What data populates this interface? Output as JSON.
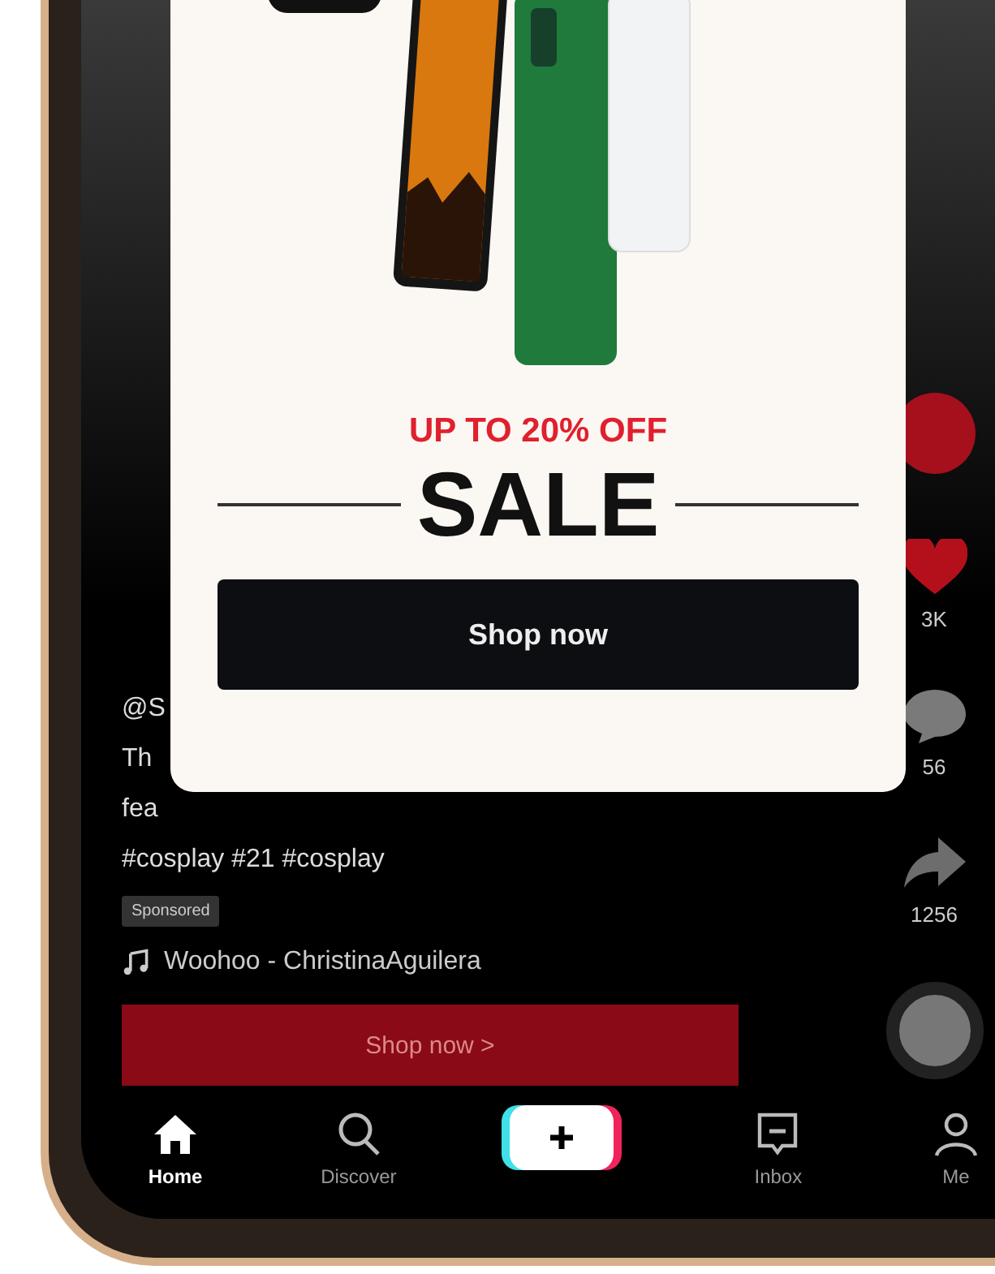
{
  "popup": {
    "offer": "UP TO 20% OFF",
    "headline": "SALE",
    "button": "Shop now"
  },
  "caption": {
    "username": "@S",
    "lines": [
      "Th",
      "fea"
    ],
    "hashtags": "#cosplay #21 #cosplay",
    "badge": "Sponsored",
    "music": "Woohoo - ChristinaAguilera"
  },
  "actions": [
    {
      "kind": "avatar"
    },
    {
      "kind": "like",
      "count": "3K"
    },
    {
      "kind": "comment",
      "count": "56"
    },
    {
      "kind": "share",
      "count": "1256"
    }
  ],
  "shop_bar": {
    "label": "Shop now >"
  },
  "nav": [
    {
      "kind": "home",
      "label": "Home",
      "selected": true
    },
    {
      "kind": "discover",
      "label": "Discover",
      "selected": false
    },
    {
      "kind": "create",
      "selected": false
    },
    {
      "kind": "inbox",
      "label": "Inbox",
      "selected": false
    },
    {
      "kind": "me",
      "label": "Me",
      "selected": false
    }
  ]
}
